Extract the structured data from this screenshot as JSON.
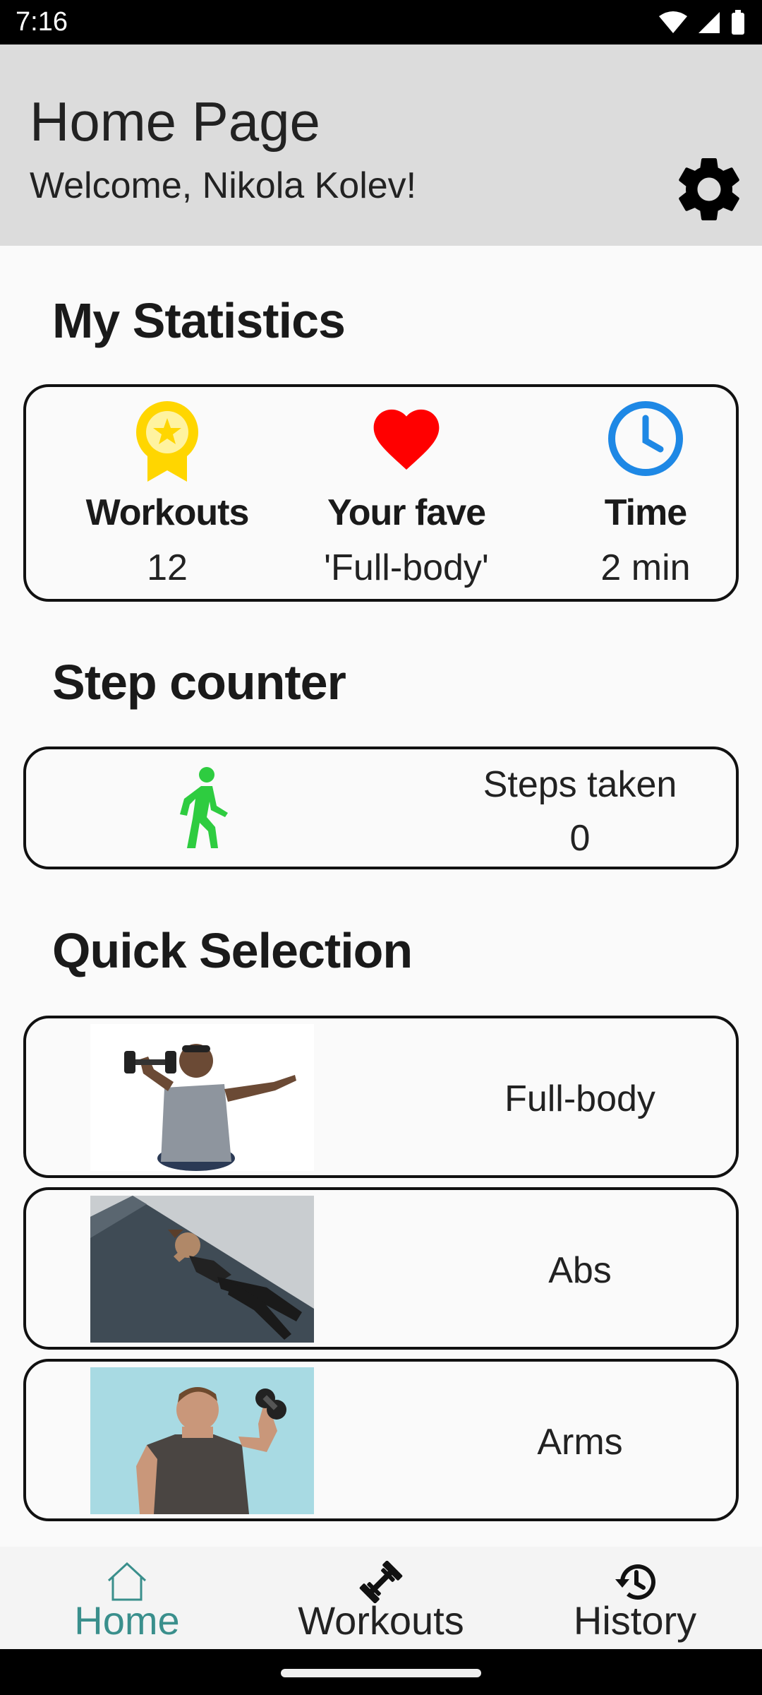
{
  "status_bar": {
    "time": "7:16",
    "icons": [
      "wifi-icon",
      "signal-icon",
      "battery-icon"
    ]
  },
  "header": {
    "title": "Home Page",
    "welcome": "Welcome, Nikola Kolev!",
    "settings_icon": "gear-icon"
  },
  "statistics": {
    "title": "My Statistics",
    "items": [
      {
        "label": "Workouts",
        "value": "12",
        "icon": "medal-icon",
        "color": "#ffd600"
      },
      {
        "label": "Your fave",
        "value": "'Full-body'",
        "icon": "heart-icon",
        "color": "#ff0000"
      },
      {
        "label": "Time",
        "value": "2 min",
        "icon": "clock-icon",
        "color": "#1e88e5"
      }
    ]
  },
  "step_counter": {
    "title": "Step counter",
    "label": "Steps taken",
    "value": "0",
    "icon": "walking-person-icon",
    "color": "#2ecc40"
  },
  "quick_selection": {
    "title": "Quick Selection",
    "items": [
      {
        "label": "Full-body",
        "image": "man-lifting-dumbbells-photo"
      },
      {
        "label": "Abs",
        "image": "woman-doing-crunches-photo"
      },
      {
        "label": "Arms",
        "image": "man-doing-curls-photo"
      }
    ]
  },
  "bottom_nav": {
    "items": [
      {
        "label": "Home",
        "icon": "home-icon",
        "active": true
      },
      {
        "label": "Workouts",
        "icon": "dumbbell-icon",
        "active": false
      },
      {
        "label": "History",
        "icon": "history-icon",
        "active": false
      }
    ],
    "active_color": "#3a8f8c"
  }
}
